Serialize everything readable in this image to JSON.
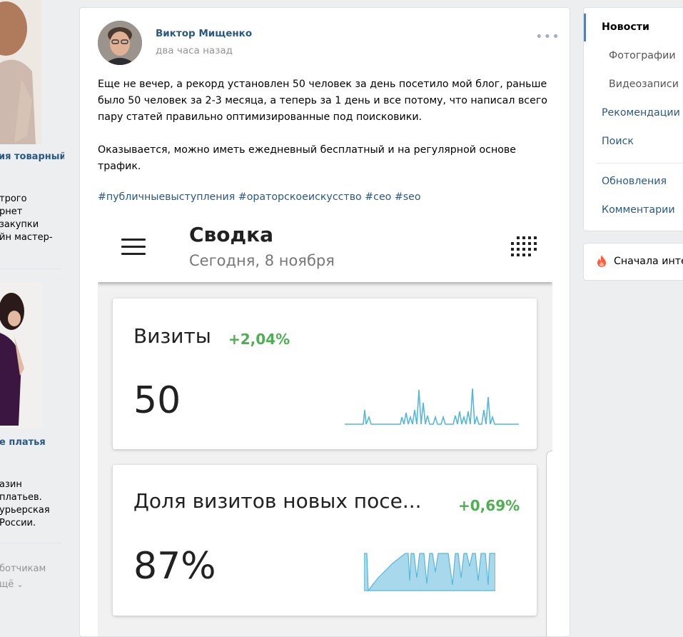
{
  "left_ads": [
    {
      "title": "ия товарный",
      "lines": [
        "трого",
        "рнет",
        "закупки",
        "йн мастер-"
      ]
    },
    {
      "title": "е платья",
      "lines": [
        "азин",
        "платьев.",
        "урьерская",
        "России."
      ]
    }
  ],
  "left_footer": {
    "line1": "ботчикам",
    "line2": "щё"
  },
  "post": {
    "author": "Виктор Мищенко",
    "time": "два часа назад",
    "menu_icon": "more-horizontal-icon",
    "paragraph1": "Еще не вечер, а рекорд установлен 50 человек за день посетило мой блог, раньше было 50 человек за 2-3 месяца, а теперь за 1 день и все потому, что написал всего пару статей правильно оптимизированные под поисковики.",
    "paragraph2": "Оказывается, можно иметь ежедневный бесплатный и на регулярной основе трафик.",
    "hashtags": [
      "#публичныевыступления",
      "#ораторскоеискусство",
      "#сео",
      "#seo"
    ]
  },
  "analytics_screenshot": {
    "title": "Сводка",
    "date": "Сегодня, 8 ноября",
    "menu_icon": "hamburger-menu-icon",
    "grid_icon": "dots-grid-icon",
    "cards": [
      {
        "label": "Визиты",
        "delta": "+2,04%",
        "value": "50"
      },
      {
        "label": "Доля визитов новых посе...",
        "delta": "+0,69%",
        "value": "87%"
      }
    ],
    "accent_color": "#4caf50",
    "spark_color": "#56b7d8"
  },
  "nav": {
    "items": [
      {
        "label": "Новости",
        "active": true
      },
      {
        "label": "Фотографии",
        "sub": true
      },
      {
        "label": "Видеозаписи",
        "sub": true
      },
      {
        "label": "Рекомендации"
      },
      {
        "label": "Поиск"
      },
      {
        "label": "Обновления"
      },
      {
        "label": "Комментарии"
      }
    ]
  },
  "filter": {
    "label": "Сначала инте",
    "icon": "fire-icon"
  },
  "colors": {
    "link": "#2a5885",
    "page_bg": "#edeef0",
    "nav_active": "#5181b8"
  }
}
